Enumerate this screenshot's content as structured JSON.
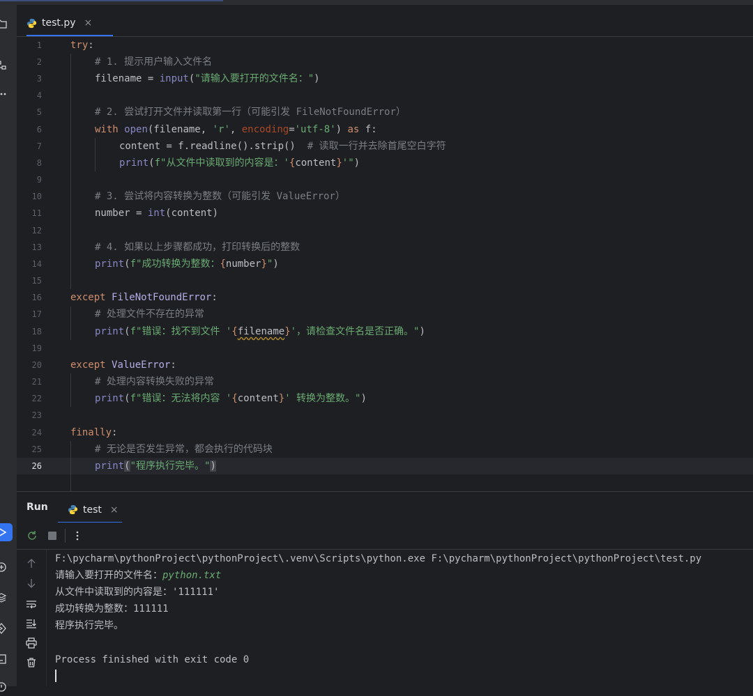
{
  "editor_tab": {
    "filename": "test.py",
    "close": "×"
  },
  "code": {
    "line_numbers": [
      "1",
      "2",
      "3",
      "4",
      "5",
      "6",
      "7",
      "8",
      "9",
      "10",
      "11",
      "12",
      "13",
      "14",
      "15",
      "16",
      "17",
      "18",
      "19",
      "20",
      "21",
      "22",
      "23",
      "24",
      "25",
      "26"
    ],
    "current_line": 26,
    "l1_try": "try",
    "l1_colon": ":",
    "l2_comment": "# 1. 提示用户输入文件名",
    "l3_var": "filename = ",
    "l3_fn": "input",
    "l3_str": "\"请输入要打开的文件名：\"",
    "l5_comment": "# 2. 尝试打开文件并读取第一行（可能引发 FileNotFoundError）",
    "l6_with": "with ",
    "l6_open": "open",
    "l6_a": "(filename, ",
    "l6_r": "'r'",
    "l6_b": ", ",
    "l6_enc": "encoding",
    "l6_eq": "=",
    "l6_utf": "'utf-8'",
    "l6_c": ") ",
    "l6_as": "as",
    "l6_d": " f:",
    "l7_code": "content = f.readline().strip()  ",
    "l7_comment": "# 读取一行并去除首尾空白字符",
    "l8_print": "print",
    "l8_a": "(",
    "l8_str1": "f\"从文件中读取到的内容是：'",
    "l8_lb": "{",
    "l8_var": "content",
    "l8_rb": "}",
    "l8_str2": "'\"",
    "l8_b": ")",
    "l10_comment": "# 3. 尝试将内容转换为整数（可能引发 ValueError）",
    "l11_a": "number = ",
    "l11_int": "int",
    "l11_b": "(content)",
    "l13_comment": "# 4. 如果以上步骤都成功，打印转换后的整数",
    "l14_print": "print",
    "l14_a": "(",
    "l14_str1": "f\"成功转换为整数：",
    "l14_lb": "{",
    "l14_var": "number",
    "l14_rb": "}",
    "l14_str2": "\"",
    "l14_b": ")",
    "l16_except": "except ",
    "l16_cls": "FileNotFoundError",
    "l16_colon": ":",
    "l17_comment": "# 处理文件不存在的异常",
    "l18_print": "print",
    "l18_a": "(",
    "l18_str1": "f\"错误：找不到文件 '",
    "l18_lb": "{",
    "l18_var": "filename",
    "l18_rb": "}",
    "l18_str2": "'，请检查文件名是否正确。\"",
    "l18_b": ")",
    "l20_except": "except ",
    "l20_cls": "ValueError",
    "l20_colon": ":",
    "l21_comment": "# 处理内容转换失败的异常",
    "l22_print": "print",
    "l22_a": "(",
    "l22_str1": "f\"错误：无法将内容 '",
    "l22_lb": "{",
    "l22_var": "content",
    "l22_rb": "}",
    "l22_str2": "' 转换为整数。\"",
    "l22_b": ")",
    "l24_finally": "finally",
    "l24_colon": ":",
    "l25_comment": "# 无论是否发生异常，都会执行的代码块",
    "l26_print": "print",
    "l26_a": "(",
    "l26_str": "\"程序执行完毕。\"",
    "l26_b": ")"
  },
  "run_panel": {
    "title": "Run",
    "tab_name": "test",
    "tab_close": "×",
    "console": {
      "command": "F:\\pycharm\\pythonProject\\pythonProject\\.venv\\Scripts\\python.exe F:\\pycharm\\pythonProject\\pythonProject\\test.py",
      "prompt": "请输入要打开的文件名：",
      "user_input": "python.txt",
      "line3": "从文件中读取到的内容是：'111111'",
      "line4": "成功转换为整数：111111",
      "line5": "程序执行完毕。",
      "exit": "Process finished with exit code 0"
    }
  },
  "icons": {
    "left_strip": [
      "folder-icon",
      "structure-icon",
      "more-icon",
      "run-icon",
      "python-packages-icon",
      "layers-icon",
      "services-icon",
      "terminal-icon",
      "problems-icon"
    ],
    "run_toolbar": [
      "rerun-icon",
      "stop-icon",
      "more-vertical-icon"
    ],
    "run_side": [
      "scroll-up-icon",
      "scroll-down-icon",
      "soft-wrap-icon",
      "scroll-to-end-icon",
      "print-icon",
      "trash-icon"
    ]
  },
  "colors": {
    "accent": "#3574f0",
    "keyword": "#cf8e6d",
    "string": "#6aab73",
    "comment": "#7a7e85",
    "builtin": "#8888c6"
  }
}
